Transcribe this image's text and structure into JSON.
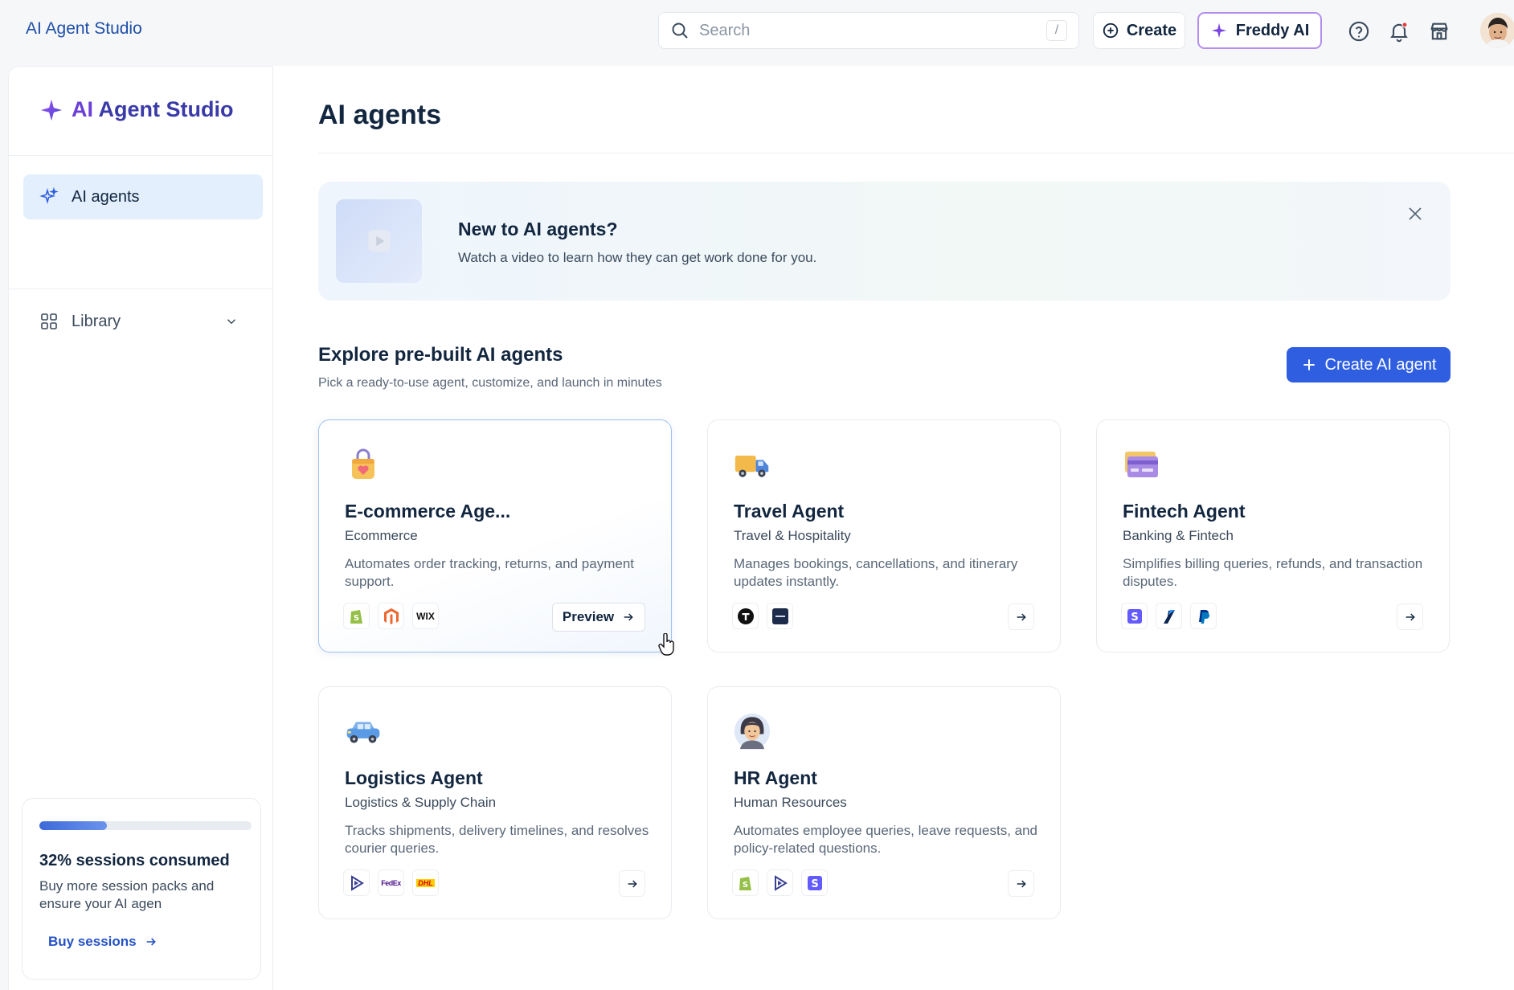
{
  "topbar": {
    "app_name": "AI Agent Studio",
    "search_placeholder": "Search",
    "search_shortcut": "/",
    "create_label": "Create",
    "freddy_label": "Freddy AI"
  },
  "sidebar": {
    "brand_part1": "AI",
    "brand_part2": "Agent Studio",
    "nav": [
      {
        "label": "AI agents",
        "icon": "sparkle-icon",
        "active": true
      },
      {
        "label": "Library",
        "icon": "library-icon",
        "active": false
      }
    ],
    "usage": {
      "progress": 0.32,
      "title": "32% sessions consumed",
      "description": "Buy more session packs and ensure your AI agen",
      "link_label": "Buy sessions"
    }
  },
  "main": {
    "page_title": "AI agents",
    "banner": {
      "title": "New to AI agents?",
      "subtitle": "Watch a video to learn how they can get work done for you."
    },
    "section_title": "Explore pre-built AI agents",
    "section_subtitle": "Pick a ready-to-use agent, customize, and launch in minutes",
    "create_button": "Create AI agent",
    "preview_label": "Preview",
    "cards": [
      {
        "title": "E-commerce Age...",
        "category": "Ecommerce",
        "description": "Automates order tracking, returns, and payment support.",
        "logos": [
          "shopify",
          "magento",
          "wix"
        ]
      },
      {
        "title": "Travel Agent",
        "category": "Travel & Hospitality",
        "description": "Manages bookings, cancellations, and itinerary updates instantly.",
        "logos": [
          "t-logo",
          "dark-square"
        ]
      },
      {
        "title": "Fintech Agent",
        "category": "Banking & Fintech",
        "description": "Simplifies billing queries, refunds, and transaction disputes.",
        "logos": [
          "stripe",
          "razorpay",
          "paypal"
        ]
      },
      {
        "title": "Logistics Agent",
        "category": "Logistics & Supply Chain",
        "description": "Tracks shipments, delivery timelines, and resolves courier queries.",
        "logos": [
          "shipment-play",
          "fedex",
          "dhl"
        ]
      },
      {
        "title": "HR Agent",
        "category": "Human Resources",
        "description": "Automates employee queries, leave requests, and policy-related questions.",
        "logos": [
          "shopify",
          "shipment-play",
          "stripe"
        ]
      }
    ],
    "logo_text": {
      "wix": "WIX",
      "fedex": "FedEx",
      "dhl": "DHL"
    }
  },
  "colors": {
    "primary": "#2f5fe0",
    "brand_purple": "#6b3fd6",
    "active_nav": "#e3effd",
    "freddy_border": "#b48df0"
  }
}
